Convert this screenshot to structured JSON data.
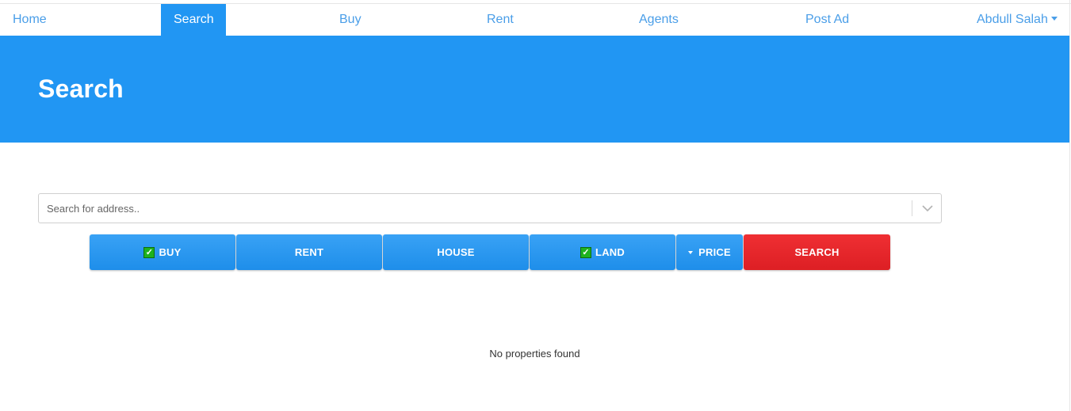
{
  "nav": {
    "home": "Home",
    "search": "Search",
    "buy": "Buy",
    "rent": "Rent",
    "agents": "Agents",
    "post_ad": "Post Ad",
    "user_name": "Abdull Salah"
  },
  "hero": {
    "title": "Search"
  },
  "search": {
    "placeholder": "Search for address.."
  },
  "filters": {
    "buy": {
      "label": "BUY",
      "checked": true
    },
    "rent": {
      "label": "RENT",
      "checked": false
    },
    "house": {
      "label": "HOUSE",
      "checked": false
    },
    "land": {
      "label": "LAND",
      "checked": true
    },
    "price": {
      "label": "PRICE"
    },
    "search": {
      "label": "SEARCH"
    }
  },
  "results": {
    "message": "No properties found"
  },
  "colors": {
    "primary": "#2196f3",
    "nav_text": "#4a9ee8",
    "danger": "#e3262a",
    "checkbox": "#1fb21f"
  },
  "icons": {
    "dropdown": "chevron-down-icon",
    "user_menu": "caret-down-icon",
    "price": "caret-down-icon",
    "checked": "check-icon"
  }
}
